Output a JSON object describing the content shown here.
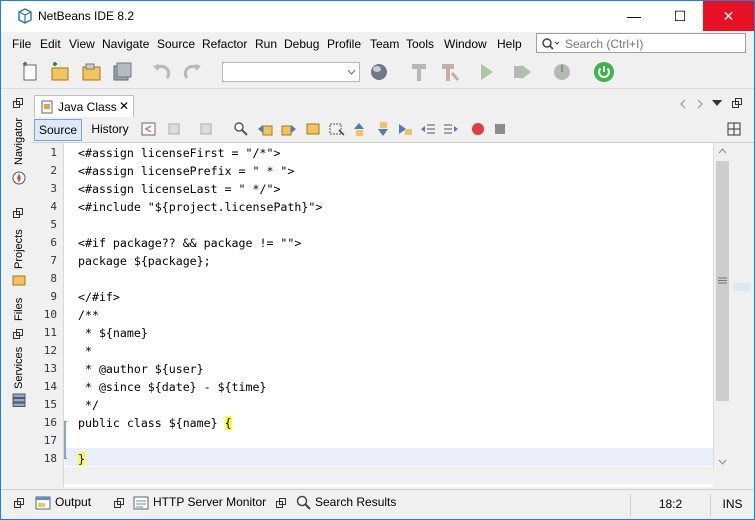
{
  "window": {
    "title": "NetBeans IDE 8.2",
    "minimize": "—",
    "maximize": "☐",
    "close": "✕"
  },
  "menu": [
    "File",
    "Edit",
    "View",
    "Navigate",
    "Source",
    "Refactor",
    "Run",
    "Debug",
    "Profile",
    "Team",
    "Tools",
    "Window",
    "Help"
  ],
  "search": {
    "placeholder": "Search (Ctrl+I)"
  },
  "sidebar": {
    "navigator": "Navigator",
    "projects": "Projects",
    "files": "Files",
    "services": "Services"
  },
  "tab": {
    "label": "Java Class",
    "close": "✕"
  },
  "editor_toolbar": {
    "source": "Source",
    "history": "History"
  },
  "line_numbers": [
    "1",
    "2",
    "3",
    "4",
    "5",
    "6",
    "7",
    "8",
    "9",
    "10",
    "11",
    "12",
    "13",
    "14",
    "15",
    "16",
    "17",
    "18"
  ],
  "code": {
    "l1": "<#assign licenseFirst = \"/*\">",
    "l2": "<#assign licensePrefix = \" * \">",
    "l3": "<#assign licenseLast = \" */\">",
    "l4": "<#include \"${project.licensePath}\">",
    "l5": "",
    "l6": "<#if package?? && package != \"\">",
    "l7": "package ${package};",
    "l8": "",
    "l9": "</#if>",
    "l10": "/**",
    "l11": " * ${name}",
    "l12": " *",
    "l13": " * @author ${user}",
    "l14": " * @since ${date} - ${time}",
    "l15": " */",
    "l16": "public class ${name} ",
    "l16_brace": "{",
    "l17": "",
    "l18_brace": "}"
  },
  "status": {
    "output": "Output",
    "http": "HTTP Server Monitor",
    "search": "Search Results",
    "position": "18:2",
    "mode": "INS"
  },
  "colors": {
    "accent": "#1883d7",
    "close": "#e81123",
    "brace_highlight": "#ffff33",
    "current_line": "#e9eff8"
  }
}
